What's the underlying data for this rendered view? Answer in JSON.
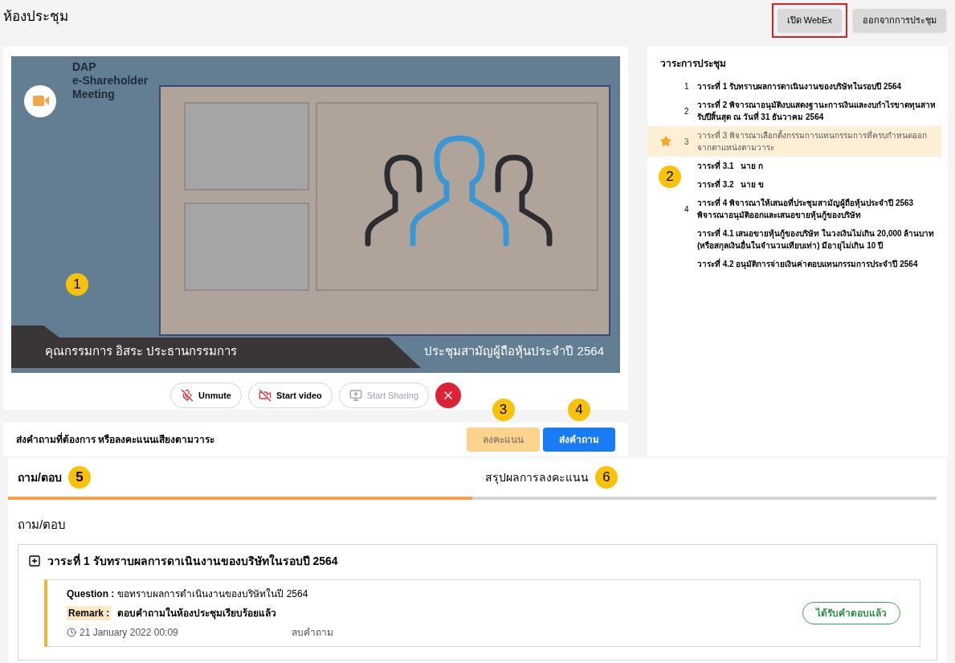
{
  "page_title": "ห้องประชุม",
  "header_buttons": [
    {
      "label": "เปิด WebEx",
      "highlighted": true
    },
    {
      "label": "ออกจากการประชุม",
      "highlighted": false
    }
  ],
  "video": {
    "logo_lines": [
      "DAP",
      "e-Shareholder",
      "Meeting"
    ],
    "caption_left": "คุณกรรมการ อิสระ ประธานกรรมการ",
    "caption_right": "ประชุมสามัญผู้ถือหุ้นประจำปี 2564"
  },
  "controls": [
    {
      "kind": "mute",
      "label": "Unmute",
      "disabled": false
    },
    {
      "kind": "video",
      "label": "Start video",
      "disabled": false
    },
    {
      "kind": "share",
      "label": "Start Sharing",
      "disabled": true
    },
    {
      "kind": "end"
    }
  ],
  "action_bar": {
    "text": "ส่งคำถามที่ต้องการ หรือลงคะแนนเสียงตามวาระ",
    "buttons": [
      {
        "label": "ลงคะแนน",
        "disabled": true
      },
      {
        "label": "ส่งคำถาม",
        "disabled": false
      }
    ]
  },
  "agenda": {
    "title": "วาระการประชุม",
    "items": [
      {
        "kind": "item",
        "number": "1",
        "text": "วาระที่ 1 รับทราบผลการดาเนินงานของบริษัทในรอบปี 2564",
        "selected": false
      },
      {
        "kind": "item",
        "number": "2",
        "text": "วาระที่ 2 พิจารณาอนุมัติงบแสดงฐานะการเงินและงบกำไรขาดทุนสาหรับปีสิ้นสุด ณ วันที่ 31 ธันวาคม 2564",
        "selected": false
      },
      {
        "kind": "item",
        "number": "3",
        "text": "วาระที่ 3 พิจารณาเลือกตั้งกรรมการแทนกรรมการที่ครบกำหนดออกจากตาแหน่งตามวาระ",
        "selected": true
      },
      {
        "kind": "sub",
        "text": "วาระที่ 3.1   นาย ก",
        "selected": false
      },
      {
        "kind": "sub",
        "text": "วาระที่ 3.2   นาย ข",
        "selected": false
      },
      {
        "kind": "item",
        "number": "4",
        "text": "วาระที่ 4 พิจารณาให้เสนอที่ประชุมสามัญผู้ถือหุ้นประจำปี 2563 พิจารณาอนุมัติออกและเสนอขายหุ้นกู้ของบริษัท",
        "selected": false
      },
      {
        "kind": "sub",
        "text": "วาระที่ 4.1 เสนอขายหุ้นกู้ของบริษัท ในวงเงินไม่เกิน 20,000 ล้านบาท (หรือสกุลเงินอื่นในจำนวนเทียบเท่า) มีอายุไม่เกิน 10 ปี",
        "selected": false
      },
      {
        "kind": "sub",
        "text": "วาระที่ 4.2 อนุมัติการจ่ายเงินค่าตอบแทนกรรมการประจำปี 2564",
        "selected": false
      }
    ]
  },
  "tabs": [
    {
      "label": "ถาม/ตอบ",
      "selected": true
    },
    {
      "label": "สรุปผลการลงคะแนน",
      "selected": false
    }
  ],
  "qa": {
    "heading": "ถาม/ตอบ",
    "groups": [
      {
        "title": "วาระที่ 1 รับทราบผลการดาเนินงานของบริษัทในรอบปี 2564",
        "expanded": false,
        "questions": [
          {
            "question_label": "Question :",
            "question": "ขอทราบผลการดำเนินงานของบริษัทในปี 2564",
            "remark_label": "Remark :",
            "remark": "ตอบคำถามในห้องประชุมเรียบร้อยแล้ว",
            "time": "21 January 2022 00:09",
            "delete": "ลบคำถาม",
            "status": "ได้รับคำตอบแล้ว"
          }
        ]
      }
    ]
  },
  "markers": [
    "1",
    "2",
    "3",
    "4",
    "5",
    "6"
  ]
}
